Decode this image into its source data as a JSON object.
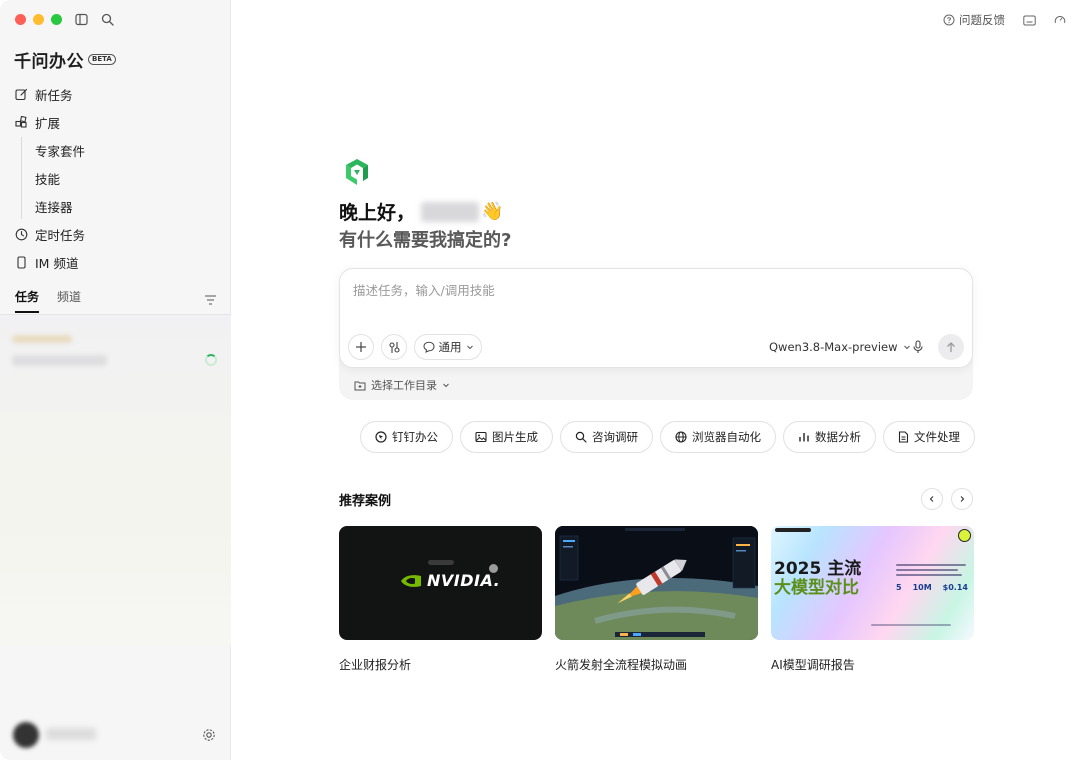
{
  "app": {
    "name": "千问办公",
    "badge": "BETA"
  },
  "sidebar": {
    "nav": [
      {
        "label": "新任务",
        "icon": "edit-icon"
      },
      {
        "label": "扩展",
        "icon": "extensions-icon"
      },
      {
        "label": "专家套件"
      },
      {
        "label": "技能"
      },
      {
        "label": "连接器"
      },
      {
        "label": "定时任务",
        "icon": "clock-icon"
      },
      {
        "label": "IM 频道",
        "icon": "phone-icon"
      }
    ],
    "tabs": [
      {
        "label": "任务",
        "active": true
      },
      {
        "label": "频道",
        "active": false
      }
    ]
  },
  "header": {
    "feedback_label": "问题反馈"
  },
  "greeting": {
    "line1": "晚上好，",
    "wave": "👋",
    "line2": "有什么需要我搞定的?"
  },
  "composer": {
    "placeholder": "描述任务，输入/调用技能",
    "mode_label": "通用",
    "model_label": "Qwen3.8-Max-preview",
    "workdir_label": "选择工作目录"
  },
  "quick_actions": [
    {
      "label": "钉钉办公",
      "icon": "dingtalk-icon"
    },
    {
      "label": "图片生成",
      "icon": "image-icon"
    },
    {
      "label": "咨询调研",
      "icon": "search-icon"
    },
    {
      "label": "浏览器自动化",
      "icon": "globe-icon"
    },
    {
      "label": "数据分析",
      "icon": "bar-chart-icon"
    },
    {
      "label": "文件处理",
      "icon": "file-icon"
    }
  ],
  "recommended": {
    "title": "推荐案例",
    "cases": [
      {
        "label": "企业财报分析",
        "thumb_text": "NVIDIA."
      },
      {
        "label": "火箭发射全流程模拟动画"
      },
      {
        "label": "AI模型调研报告",
        "thumb_title": "2025 主流",
        "thumb_subtitle": "大模型对比",
        "stats": [
          "5",
          "10M",
          "$0.14"
        ]
      }
    ]
  },
  "colors": {
    "accent_green": "#2db55d",
    "nvidia_green": "#76b900"
  }
}
